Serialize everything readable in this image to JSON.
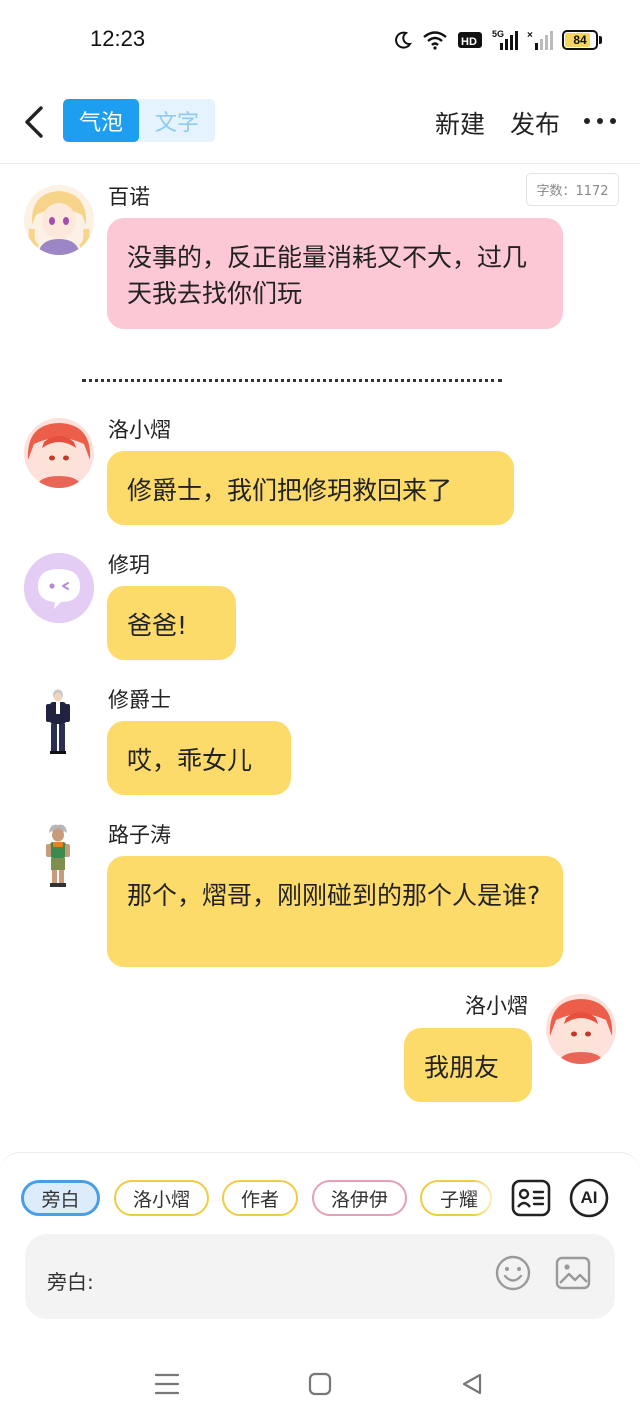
{
  "status_bar": {
    "time": "12:23",
    "battery": "84",
    "battery_percent": 84,
    "icons": [
      "moon-icon",
      "wifi-icon",
      "hd-icon",
      "signal-5g-icon",
      "signal-nosim-icon",
      "battery-icon"
    ]
  },
  "header": {
    "tabs": [
      {
        "label": "气泡",
        "active": true
      },
      {
        "label": "文字",
        "active": false
      }
    ],
    "new_label": "新建",
    "publish_label": "发布"
  },
  "word_count": "字数：1172",
  "messages": [
    {
      "speaker": "百诺",
      "text": "没事的，反正能量消耗又不大，过几天我去找你们玩",
      "bubble_color": "#fdc8d5"
    },
    {
      "speaker": "洛小熠",
      "text": "修爵士，我们把修玥救回来了",
      "bubble_color": "#fddb6b"
    },
    {
      "speaker": "修玥",
      "text": "爸爸!",
      "bubble_color": "#fddb6b"
    },
    {
      "speaker": "修爵士",
      "text": "哎，乖女儿",
      "bubble_color": "#fddb6b"
    },
    {
      "speaker": "路子涛",
      "text": "那个，熠哥，刚刚碰到的那个人是谁?",
      "bubble_color": "#fddb6b"
    },
    {
      "speaker": "洛小熠",
      "text": "我朋友",
      "bubble_color": "#fddb6b"
    }
  ],
  "roles": [
    {
      "label": "旁白",
      "active": true
    },
    {
      "label": "洛小熠",
      "active": false
    },
    {
      "label": "作者",
      "active": false
    },
    {
      "label": "洛伊伊",
      "active": false
    },
    {
      "label": "子耀",
      "active": false
    }
  ],
  "ai_label": "AI",
  "input": {
    "label": "旁白:"
  },
  "colors": {
    "accent": "#1e9ef0",
    "pink_bubble": "#fdc8d5",
    "yellow_bubble": "#fddb6b"
  }
}
